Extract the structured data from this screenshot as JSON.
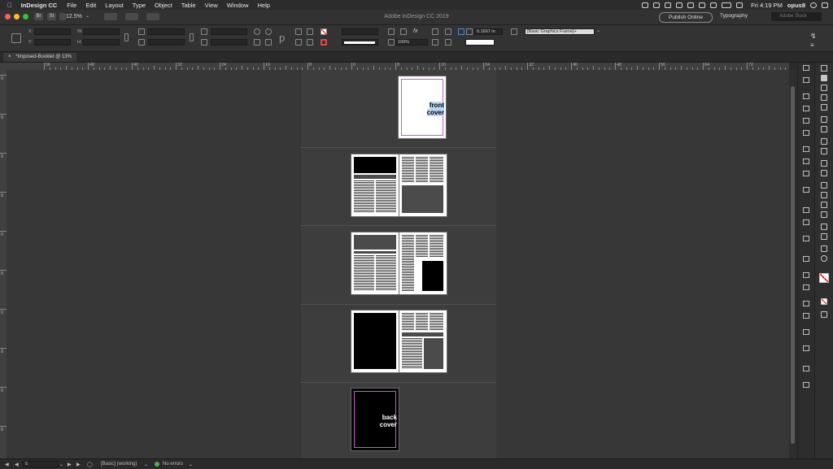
{
  "menubar": {
    "app_name": "InDesign CC",
    "items": [
      "File",
      "Edit",
      "Layout",
      "Type",
      "Object",
      "Table",
      "View",
      "Window",
      "Help"
    ],
    "clock": "Fri 4:19 PM",
    "user": "opus8"
  },
  "titlebar": {
    "zoom": "12.5%",
    "window_title": "Adobe InDesign CC 2019",
    "publish_label": "Publish Online",
    "workspace": "Typography",
    "search_placeholder": "Adobe Stock",
    "br_label": "Br",
    "st_label": "St"
  },
  "control": {
    "x_label": "X:",
    "y_label": "Y:",
    "w_label": "W:",
    "h_label": "H:",
    "stroke_weight": "0.1667 in",
    "scale_percent": "100%",
    "object_style": "[Basic Graphics Frame]+"
  },
  "document_tab": {
    "close": "×",
    "label": "*Imposed-Booklet @ 13%"
  },
  "ruler": {
    "h_labels": [
      "56",
      "48",
      "40",
      "32",
      "24",
      "16",
      "8",
      "0",
      "8",
      "16",
      "24",
      "32",
      "40",
      "48",
      "56",
      "64",
      "72"
    ],
    "v_labels": [
      "0",
      "8",
      "0",
      "8",
      "0",
      "8",
      "0",
      "8",
      "0",
      "8"
    ]
  },
  "pages": {
    "front_cover_text": [
      "front",
      "cover"
    ],
    "back_cover_text": [
      "back",
      "cover"
    ]
  },
  "status": {
    "page_number": "5",
    "preflight_profile": "[Basic] (working)",
    "errors": "No errors",
    "error_color": "#4caf50"
  },
  "colors": {
    "margin_guide": "#c95bd0",
    "close_red": "#fe5f57",
    "minimize_yellow": "#febc2e",
    "zoom_green": "#28c840"
  }
}
